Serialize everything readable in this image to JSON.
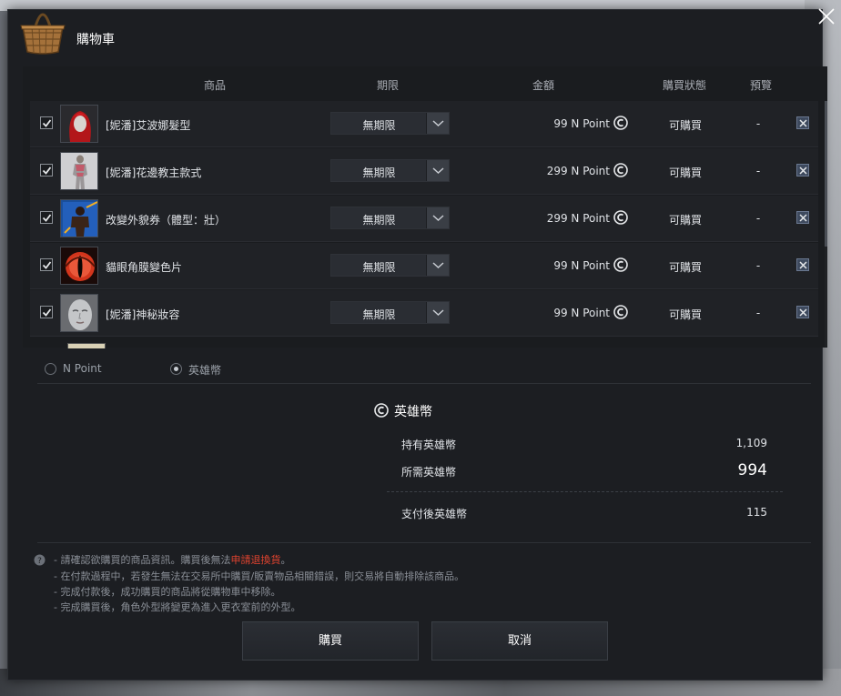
{
  "window": {
    "title": "購物車",
    "icons": {
      "basket": "basket-icon",
      "close": "close-icon"
    }
  },
  "columns": {
    "product": "商品",
    "period": "期限",
    "amount": "金額",
    "status": "購買狀態",
    "preview": "預覽"
  },
  "items": [
    {
      "name": "[妮潘]艾波娜髮型",
      "period": "無期限",
      "price": "99 N Point",
      "status": "可購買",
      "preview": "-",
      "checked": true,
      "thumb": "red-hair"
    },
    {
      "name": "[妮潘]花邊教主款式",
      "period": "無期限",
      "price": "299 N Point",
      "status": "可購買",
      "preview": "-",
      "checked": true,
      "thumb": "outfit"
    },
    {
      "name": "改變外貌券（體型：壯）",
      "period": "無期限",
      "price": "299 N Point",
      "status": "可購買",
      "preview": "-",
      "checked": true,
      "thumb": "body-coupon"
    },
    {
      "name": "貓眼角膜變色片",
      "period": "無期限",
      "price": "99 N Point",
      "status": "可購買",
      "preview": "-",
      "checked": true,
      "thumb": "cat-eye"
    },
    {
      "name": "[妮潘]神秘妝容",
      "period": "無期限",
      "price": "99 N Point",
      "status": "可購買",
      "preview": "-",
      "checked": true,
      "thumb": "face"
    }
  ],
  "currency_options": [
    {
      "label": "N Point",
      "selected": false
    },
    {
      "label": "英雄幣",
      "selected": true
    }
  ],
  "summary": {
    "title": "英雄幣",
    "owned_label": "持有英雄幣",
    "owned_value": "1,109",
    "required_label": "所需英雄幣",
    "required_value": "994",
    "after_label": "支付後英雄幣",
    "after_value": "115"
  },
  "notes": {
    "line1_prefix": "- 請確認欲購買的商品資訊。購買後無法",
    "line1_highlight": "申請退換貨",
    "line1_suffix": "。",
    "line2": "- 在付款過程中，若發生無法在交易所中購買/販賣物品相關錯誤，則交易將自動排除該商品。",
    "line3": "- 完成付款後，成功購買的商品將從購物車中移除。",
    "line4": "- 完成購買後，角色外型將變更為進入更衣室前的外型。"
  },
  "buttons": {
    "buy": "購買",
    "cancel": "取消"
  },
  "colors": {
    "highlight": "#e0432f",
    "panel": "#1c1e22"
  }
}
